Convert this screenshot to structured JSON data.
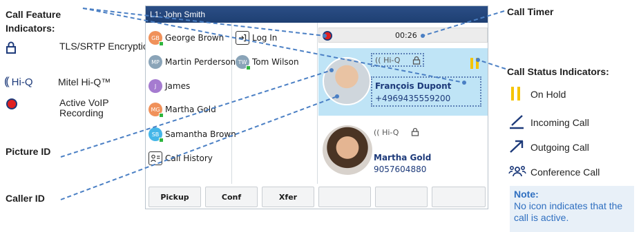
{
  "labels": {
    "call_feature_indicators": "Call Feature Indicators:",
    "picture_id": "Picture ID",
    "caller_id": "Caller ID",
    "call_timer": "Call Timer",
    "call_status_indicators": "Call Status Indicators:"
  },
  "feature_legend": [
    {
      "icon": "lock-icon",
      "text": "TLS/SRTP Encryption"
    },
    {
      "icon": "hiq-icon",
      "icon_text": "Hi-Q",
      "text": "Mitel Hi-Q™"
    },
    {
      "icon": "record-icon",
      "text": "Active VoIP Recording"
    }
  ],
  "status_legend": [
    {
      "icon": "hold-icon",
      "text": "On Hold"
    },
    {
      "icon": "incoming-call-icon",
      "text": "Incoming Call"
    },
    {
      "icon": "outgoing-call-icon",
      "text": "Outgoing Call"
    },
    {
      "icon": "conference-call-icon",
      "text": "Conference Call"
    }
  ],
  "note": {
    "title": "Note:",
    "text": "No icon indicates that the call is active."
  },
  "phone": {
    "title": "L1: John Smith",
    "contacts_col1": [
      {
        "initials": "GB",
        "name": "George Brown",
        "color": "#f0915a",
        "presence": true
      },
      {
        "initials": "MP",
        "name": "Martin Perderson",
        "color": "#8aa4b8",
        "presence": false
      },
      {
        "initials": "J",
        "name": "James",
        "color": "#a57bd0",
        "presence": false
      },
      {
        "initials": "MG",
        "name": "Martha Gold",
        "color": "#f0915a",
        "presence": true
      },
      {
        "initials": "SB",
        "name": "Samantha Brown",
        "color": "#45b6e8",
        "presence": true
      }
    ],
    "call_history": "Call History",
    "log_in": "Log In",
    "contacts_col2": [
      {
        "initials": "TW",
        "name": "Tom Wilson",
        "color": "#8aa4b8",
        "presence": true
      }
    ],
    "timer": "00:26",
    "calls": [
      {
        "name": "François Dupont",
        "number": "+4969435559200",
        "hiq": "Hi-Q",
        "status": "hold"
      },
      {
        "name": "Martha Gold",
        "number": "9057604880",
        "hiq": "Hi-Q",
        "status": "active"
      }
    ],
    "softkeys": [
      "Pickup",
      "Conf",
      "Xfer",
      "",
      "",
      ""
    ]
  },
  "colors": {
    "accent_blue": "#2f6fc0",
    "hold_yellow": "#f5c400",
    "record_red": "#e02020",
    "active_call_bg": "#bfe4f6"
  }
}
